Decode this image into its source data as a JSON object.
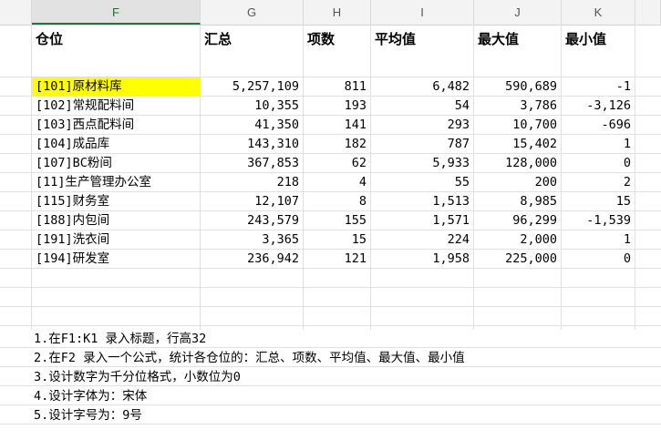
{
  "columns": [
    "F",
    "G",
    "H",
    "I",
    "J",
    "K"
  ],
  "active_column": "F",
  "headers": [
    "仓位",
    "汇总",
    "项数",
    "平均值",
    "最大值",
    "最小值"
  ],
  "rows": [
    [
      "[101]原材料库",
      "5,257,109",
      "811",
      "6,482",
      "590,689",
      "-1"
    ],
    [
      "[102]常规配料间",
      "10,355",
      "193",
      "54",
      "3,786",
      "-3,126"
    ],
    [
      "[103]西点配料间",
      "41,350",
      "141",
      "293",
      "10,700",
      "-696"
    ],
    [
      "[104]成品库",
      "143,310",
      "182",
      "787",
      "15,402",
      "1"
    ],
    [
      "[107]BC粉间",
      "367,853",
      "62",
      "5,933",
      "128,000",
      "0"
    ],
    [
      "[11]生产管理办公室",
      "218",
      "4",
      "55",
      "200",
      "2"
    ],
    [
      "[115]财务室",
      "12,107",
      "8",
      "1,513",
      "8,985",
      "15"
    ],
    [
      "[188]内包间",
      "243,579",
      "155",
      "1,571",
      "96,299",
      "-1,539"
    ],
    [
      "[191]洗衣间",
      "3,365",
      "15",
      "224",
      "2,000",
      "1"
    ],
    [
      "[194]研发室",
      "236,942",
      "121",
      "1,958",
      "225,000",
      "0"
    ]
  ],
  "highlight_color": "#ffff00",
  "notes": [
    "1.在F1:K1 录入标题，行高32",
    "2.在F2 录入一个公式，统计各仓位的：汇总、项数、平均值、最大值、最小值",
    "3.设计数字为千分位格式，小数位为0",
    "4.设计字体为：宋体",
    "5.设计字号为：9号"
  ]
}
